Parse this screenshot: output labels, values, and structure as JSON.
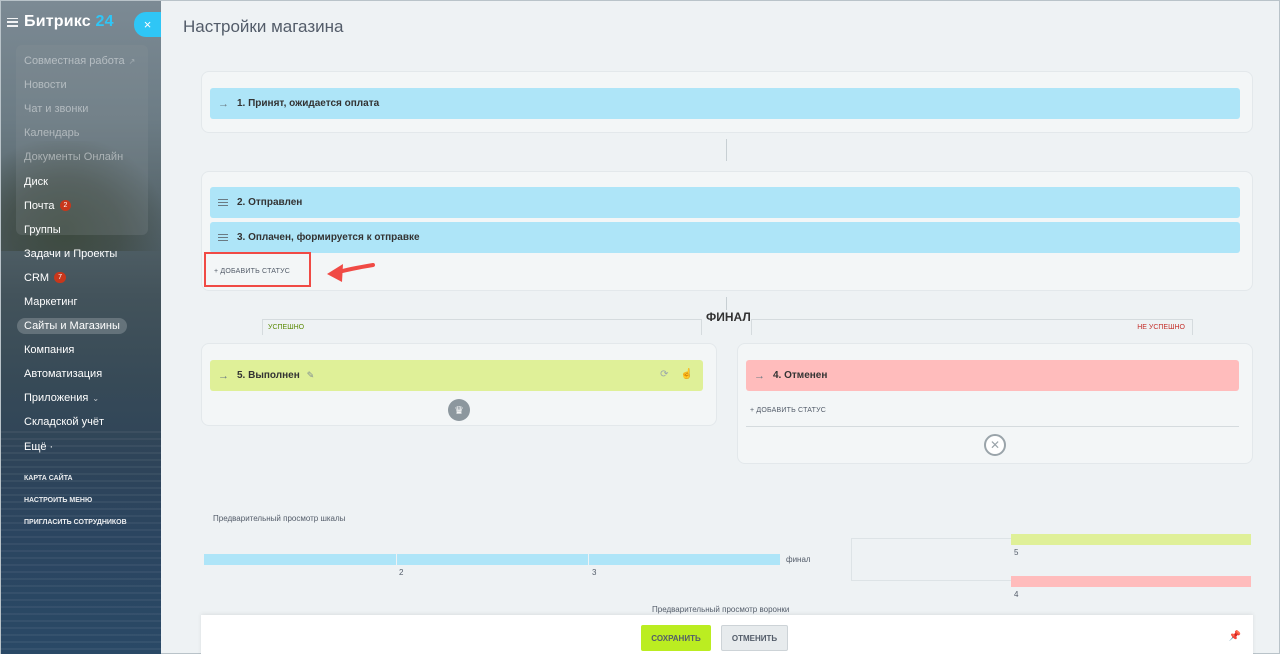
{
  "sidebar": {
    "logo_text": "Битрикс",
    "logo_num": "24",
    "collapse_icon": "×",
    "items": [
      {
        "label": "Совместная работа",
        "dim": true,
        "caret": "↗"
      },
      {
        "label": "Новости",
        "dim": true
      },
      {
        "label": "Чат и звонки",
        "dim": true
      },
      {
        "label": "Календарь",
        "dim": true
      },
      {
        "label": "Документы Онлайн",
        "dim": true
      },
      {
        "label": "Диск"
      },
      {
        "label": "Почта",
        "badge": "2"
      },
      {
        "label": "Группы"
      },
      {
        "label": "Задачи и Проекты"
      },
      {
        "label": "CRM",
        "badge": "7"
      },
      {
        "label": "Маркетинг"
      },
      {
        "label": "Сайты и Магазины",
        "active": true
      },
      {
        "label": "Компания"
      },
      {
        "label": "Автоматизация"
      },
      {
        "label": "Приложения",
        "caret": "⌄"
      },
      {
        "label": "Складской учёт"
      },
      {
        "label": "Ещё ·"
      }
    ],
    "system_links": [
      "КАРТА САЙТА",
      "НАСТРОИТЬ МЕНЮ",
      "ПРИГЛАСИТЬ СОТРУДНИКОВ"
    ]
  },
  "page": {
    "title": "Настройки магазина"
  },
  "statuses": {
    "initial": {
      "label": "1. Принят, ожидается оплата"
    },
    "intermediate": [
      {
        "label": "2. Отправлен"
      },
      {
        "label": "3. Оплачен, формируется к отправке"
      }
    ],
    "add_status_label": "+ ДОБАВИТЬ СТАТУС",
    "final_label": "ФИНАЛ",
    "success_tag": "УСПЕШНО",
    "fail_tag": "НЕ УСПЕШНО",
    "success": {
      "label": "5. Выполнен"
    },
    "fail": {
      "label": "4. Отменен"
    },
    "add_fail_status_label": "+ ДОБАВИТЬ СТАТУС"
  },
  "preview": {
    "scale_title": "Предварительный просмотр шкалы",
    "scale_numbers": [
      "2",
      "3"
    ],
    "scale_final": "финал",
    "funnel_numbers": [
      "5",
      "4"
    ],
    "funnel_title": "Предварительный просмотр воронки"
  },
  "footer": {
    "save_label": "СОХРАНИТЬ",
    "cancel_label": "ОТМЕНИТЬ"
  },
  "colors": {
    "accent": "#2fc6f6",
    "status_blue": "#aee5f8",
    "status_green": "#dff098",
    "status_red": "#ffbcbc",
    "save_button": "#bbed21",
    "highlight": "#f04a45"
  }
}
